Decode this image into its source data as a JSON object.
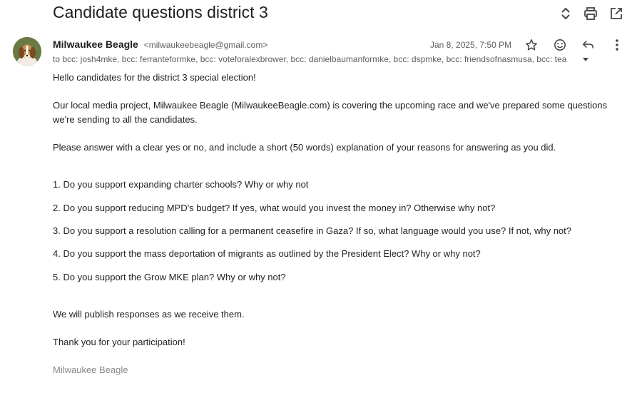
{
  "email": {
    "subject": "Candidate questions district 3",
    "sender_name": "Milwaukee Beagle",
    "sender_email": "<milwaukeebeagle@gmail.com>",
    "recipients": "to bcc: josh4mke, bcc: ferranteformke, bcc: voteforalexbrower, bcc: danielbaumanformke, bcc: dspmke, bcc: friendsofnasmusa, bcc: tea",
    "date": "Jan 8, 2025, 7:50 PM"
  },
  "icons": {
    "top": [
      "chevron-up-down-icon",
      "print-icon",
      "open-in-new-window-icon"
    ],
    "header": [
      "star-icon",
      "emoji-reaction-icon",
      "reply-icon",
      "more-options-icon"
    ],
    "recipients_toggle": "caret-down-icon",
    "avatar": "beagle-avatar"
  },
  "body": {
    "greeting": "Hello candidates for the district 3 special election!",
    "intro_line1": "Our local media project, Milwaukee Beagle (MilwaukeeBeagle.com) is covering the upcoming race and we've prepared some questions",
    "intro_line2": "we're sending to all the candidates.",
    "instructions": "Please answer with a clear yes or no, and include a short (50 words) explanation of your reasons for answering as you did.",
    "questions": [
      "1. Do you support expanding charter schools? Why or why not",
      "2. Do you support reducing MPD's budget? If yes, what would you invest the money in? Otherwise why not?",
      "3. Do you support a resolution calling for a permanent ceasefire in Gaza? If so, what language would you use? If not, why not?",
      "4. Do you support the mass deportation of migrants as outlined by the President Elect? Why or why not?",
      "5. Do you support the Grow MKE plan? Why or why not?"
    ],
    "publish_note": "We will publish responses as we receive them.",
    "thanks": "Thank you for your participation!",
    "signature": "Milwaukee Beagle"
  }
}
